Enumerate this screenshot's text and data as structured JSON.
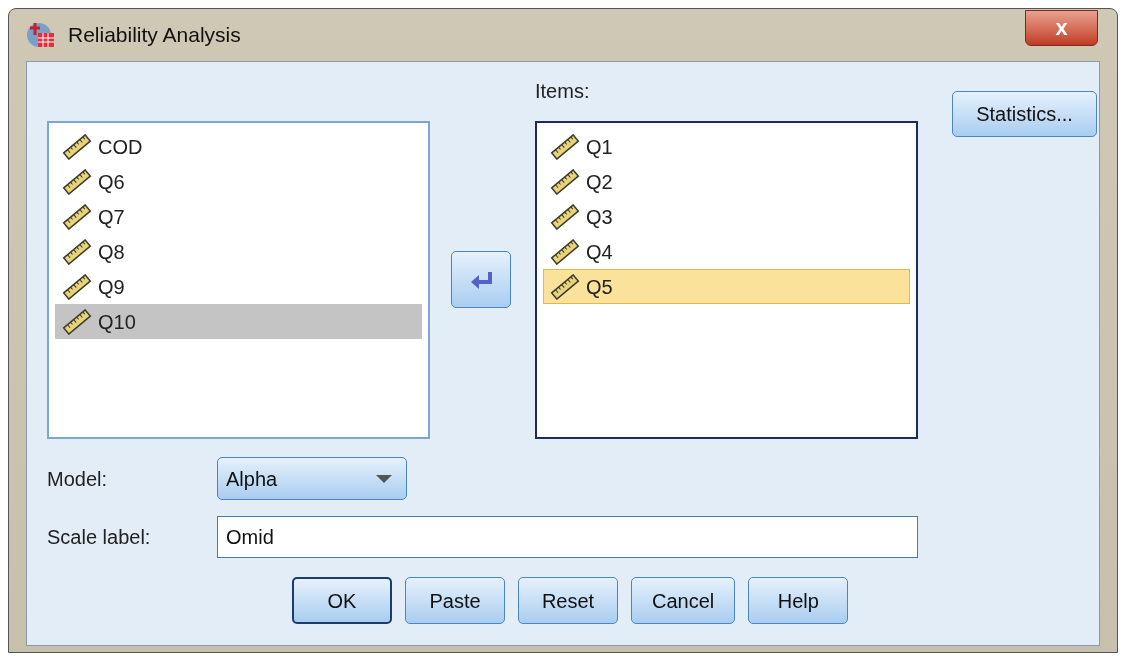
{
  "window": {
    "title": "Reliability Analysis",
    "close": "x"
  },
  "source_list": {
    "focused": false,
    "items": [
      {
        "label": "COD",
        "selected": false
      },
      {
        "label": "Q6",
        "selected": false
      },
      {
        "label": "Q7",
        "selected": false
      },
      {
        "label": "Q8",
        "selected": false
      },
      {
        "label": "Q9",
        "selected": false
      },
      {
        "label": "Q10",
        "selected": true
      }
    ]
  },
  "items_list": {
    "label": "Items:",
    "focused": true,
    "items": [
      {
        "label": "Q1",
        "selected": false
      },
      {
        "label": "Q2",
        "selected": false
      },
      {
        "label": "Q3",
        "selected": false
      },
      {
        "label": "Q4",
        "selected": false
      },
      {
        "label": "Q5",
        "selected": true
      }
    ]
  },
  "statistics_button": "Statistics...",
  "model": {
    "label": "Model:",
    "value": "Alpha"
  },
  "scale_label": {
    "label": "Scale label:",
    "value": "Omid"
  },
  "buttons": [
    {
      "label": "OK",
      "default": true
    },
    {
      "label": "Paste",
      "default": false
    },
    {
      "label": "Reset",
      "default": false
    },
    {
      "label": "Cancel",
      "default": false
    },
    {
      "label": "Help",
      "default": false
    }
  ]
}
